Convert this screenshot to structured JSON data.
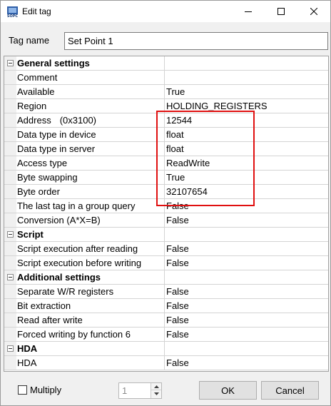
{
  "window": {
    "title": "Edit tag",
    "icon": "opc-app-icon"
  },
  "tag_name": {
    "label": "Tag name",
    "value": "Set Point 1"
  },
  "properties": {
    "general": {
      "title": "General settings",
      "rows": [
        {
          "name": "Comment",
          "value": ""
        },
        {
          "name": "Available",
          "value": "True"
        },
        {
          "name": "Region",
          "value": "HOLDING_REGISTERS"
        },
        {
          "name": "Address",
          "name_extra": "(0x3100)",
          "value": "12544"
        },
        {
          "name": "Data type in device",
          "value": "float"
        },
        {
          "name": "Data type in server",
          "value": "float"
        },
        {
          "name": "Access type",
          "value": "ReadWrite"
        },
        {
          "name": "Byte swapping",
          "value": "True"
        },
        {
          "name": "Byte order",
          "value": "32107654"
        },
        {
          "name": "The last tag in a group query",
          "value": "False"
        },
        {
          "name": "Conversion (A*X=B)",
          "value": "False"
        }
      ]
    },
    "script": {
      "title": "Script",
      "rows": [
        {
          "name": "Script execution after reading",
          "value": "False"
        },
        {
          "name": "Script execution before writing",
          "value": "False"
        }
      ]
    },
    "additional": {
      "title": "Additional settings",
      "rows": [
        {
          "name": "Separate W/R registers",
          "value": "False"
        },
        {
          "name": "Bit extraction",
          "value": "False"
        },
        {
          "name": "Read after write",
          "value": "False"
        },
        {
          "name": "Forced writing by function 6",
          "value": "False"
        }
      ]
    },
    "hda": {
      "title": "HDA",
      "rows": [
        {
          "name": "HDA",
          "value": "False"
        }
      ]
    }
  },
  "footer": {
    "multiply_label": "Multiply",
    "multiply_checked": false,
    "multiplier_value": "1",
    "ok_label": "OK",
    "cancel_label": "Cancel"
  },
  "colors": {
    "highlight": "#e01010"
  }
}
